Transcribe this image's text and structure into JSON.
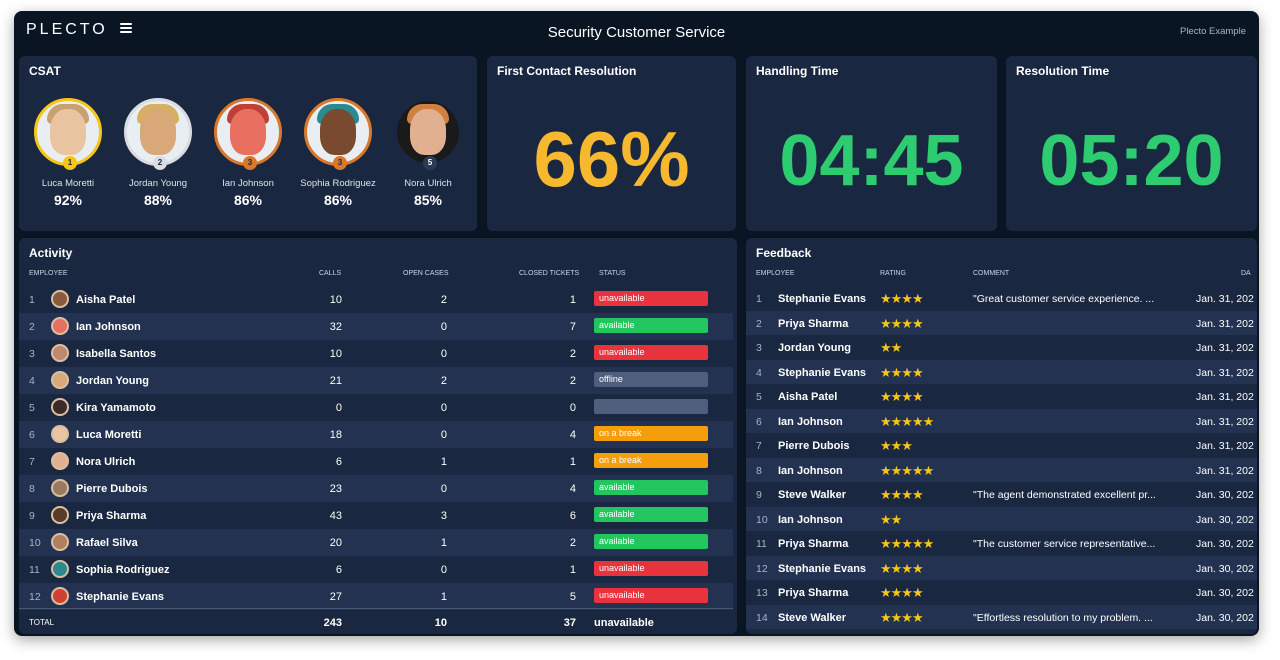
{
  "header": {
    "logo": "PLECTO",
    "title": "Security Customer Service",
    "example_label": "Plecto Example"
  },
  "csat": {
    "title": "CSAT",
    "people": [
      {
        "name": "Luca Moretti",
        "pct": "92%",
        "rank": "1",
        "ring": "#f5c518",
        "badge": "#f5c518",
        "skin": "#e8c4a0",
        "hair": "#c9a070"
      },
      {
        "name": "Jordan Young",
        "pct": "88%",
        "rank": "2",
        "ring": "#d9dde3",
        "badge": "#d9dde3",
        "skin": "#d9a878",
        "hair": "#d4b060"
      },
      {
        "name": "Ian Johnson",
        "pct": "86%",
        "rank": "3",
        "ring": "#d9772a",
        "badge": "#d9772a",
        "skin": "#e87060",
        "hair": "#c04038"
      },
      {
        "name": "Sophia Rodriguez",
        "pct": "86%",
        "rank": "3",
        "ring": "#d9772a",
        "badge": "#d9772a",
        "skin": "#7a4a30",
        "hair": "#2a8a90"
      },
      {
        "name": "Nora Ulrich",
        "pct": "85%",
        "rank": "5",
        "ring": "#1a2740",
        "badge": "#2a3a58",
        "skin": "#e0b090",
        "hair": "#d08040"
      }
    ]
  },
  "fcr": {
    "title": "First Contact Resolution",
    "value": "66%",
    "color": "#f5b82e"
  },
  "handling": {
    "title": "Handling Time",
    "value": "04:45",
    "color": "#2ecc71"
  },
  "resolution": {
    "title": "Resolution Time",
    "value": "05:20",
    "color": "#2ecc71"
  },
  "activity": {
    "title": "Activity",
    "columns": {
      "employee": "EMPLOYEE",
      "calls": "CALLS",
      "open": "OPEN CASES",
      "closed": "CLOSED TICKETS",
      "status": "STATUS"
    },
    "rows": [
      {
        "n": "1",
        "name": "Aisha Patel",
        "calls": "10",
        "open": "2",
        "closed": "1",
        "status": "unavailable",
        "color": "#e8333d",
        "av": "#8a5a3a"
      },
      {
        "n": "2",
        "name": "Ian Johnson",
        "calls": "32",
        "open": "0",
        "closed": "7",
        "status": "available",
        "color": "#22c55e",
        "av": "#e87060"
      },
      {
        "n": "3",
        "name": "Isabella Santos",
        "calls": "10",
        "open": "0",
        "closed": "2",
        "status": "unavailable",
        "color": "#e8333d",
        "av": "#c08870"
      },
      {
        "n": "4",
        "name": "Jordan Young",
        "calls": "21",
        "open": "2",
        "closed": "2",
        "status": "offline",
        "color": "#4e5e7c",
        "av": "#d9a878"
      },
      {
        "n": "5",
        "name": "Kira Yamamoto",
        "calls": "0",
        "open": "0",
        "closed": "0",
        "status": "",
        "color": "#4e5e7c",
        "av": "#3a2a2a"
      },
      {
        "n": "6",
        "name": "Luca Moretti",
        "calls": "18",
        "open": "0",
        "closed": "4",
        "status": "on a break",
        "color": "#f59e0b",
        "av": "#e8c4a0"
      },
      {
        "n": "7",
        "name": "Nora Ulrich",
        "calls": "6",
        "open": "1",
        "closed": "1",
        "status": "on a break",
        "color": "#f59e0b",
        "av": "#e0b090"
      },
      {
        "n": "8",
        "name": "Pierre Dubois",
        "calls": "23",
        "open": "0",
        "closed": "4",
        "status": "available",
        "color": "#22c55e",
        "av": "#9a7a60"
      },
      {
        "n": "9",
        "name": "Priya Sharma",
        "calls": "43",
        "open": "3",
        "closed": "6",
        "status": "available",
        "color": "#22c55e",
        "av": "#5a3a2a"
      },
      {
        "n": "10",
        "name": "Rafael Silva",
        "calls": "20",
        "open": "1",
        "closed": "2",
        "status": "available",
        "color": "#22c55e",
        "av": "#b08060"
      },
      {
        "n": "11",
        "name": "Sophia Rodriguez",
        "calls": "6",
        "open": "0",
        "closed": "1",
        "status": "unavailable",
        "color": "#e8333d",
        "av": "#2a8a90"
      },
      {
        "n": "12",
        "name": "Stephanie Evans",
        "calls": "27",
        "open": "1",
        "closed": "5",
        "status": "unavailable",
        "color": "#e8333d",
        "av": "#d04030"
      }
    ],
    "total": {
      "label": "TOTAL",
      "calls": "243",
      "open": "10",
      "closed": "37",
      "status": "unavailable"
    }
  },
  "feedback": {
    "title": "Feedback",
    "columns": {
      "employee": "EMPLOYEE",
      "rating": "RATING",
      "comment": "COMMENT",
      "date": "DA"
    },
    "rows": [
      {
        "n": "1",
        "name": "Stephanie Evans",
        "stars": "★★★★",
        "comment": "\"Great customer service experience. ...",
        "date": "Jan. 31, 202"
      },
      {
        "n": "2",
        "name": "Priya Sharma",
        "stars": "★★★★",
        "comment": "",
        "date": "Jan. 31, 202"
      },
      {
        "n": "3",
        "name": "Jordan Young",
        "stars": "★★",
        "comment": "",
        "date": "Jan. 31, 202"
      },
      {
        "n": "4",
        "name": "Stephanie Evans",
        "stars": "★★★★",
        "comment": "",
        "date": "Jan. 31, 202"
      },
      {
        "n": "5",
        "name": "Aisha Patel",
        "stars": "★★★★",
        "comment": "",
        "date": "Jan. 31, 202"
      },
      {
        "n": "6",
        "name": "Ian Johnson",
        "stars": "★★★★★",
        "comment": "",
        "date": "Jan. 31, 202"
      },
      {
        "n": "7",
        "name": "Pierre Dubois",
        "stars": "★★★",
        "comment": "",
        "date": "Jan. 31, 202"
      },
      {
        "n": "8",
        "name": "Ian Johnson",
        "stars": "★★★★★",
        "comment": "",
        "date": "Jan. 31, 202"
      },
      {
        "n": "9",
        "name": "Steve Walker",
        "stars": "★★★★",
        "comment": "\"The agent demonstrated excellent pr...",
        "date": "Jan. 30, 202"
      },
      {
        "n": "10",
        "name": "Ian Johnson",
        "stars": "★★",
        "comment": "",
        "date": "Jan. 30, 202"
      },
      {
        "n": "11",
        "name": "Priya Sharma",
        "stars": "★★★★★",
        "comment": "\"The customer service representative...",
        "date": "Jan. 30, 202"
      },
      {
        "n": "12",
        "name": "Stephanie Evans",
        "stars": "★★★★",
        "comment": "",
        "date": "Jan. 30, 202"
      },
      {
        "n": "13",
        "name": "Priya Sharma",
        "stars": "★★★★",
        "comment": "",
        "date": "Jan. 30, 202"
      },
      {
        "n": "14",
        "name": "Steve Walker",
        "stars": "★★★★",
        "comment": "\"Effortless resolution to my problem. ...",
        "date": "Jan. 30, 202"
      }
    ]
  }
}
